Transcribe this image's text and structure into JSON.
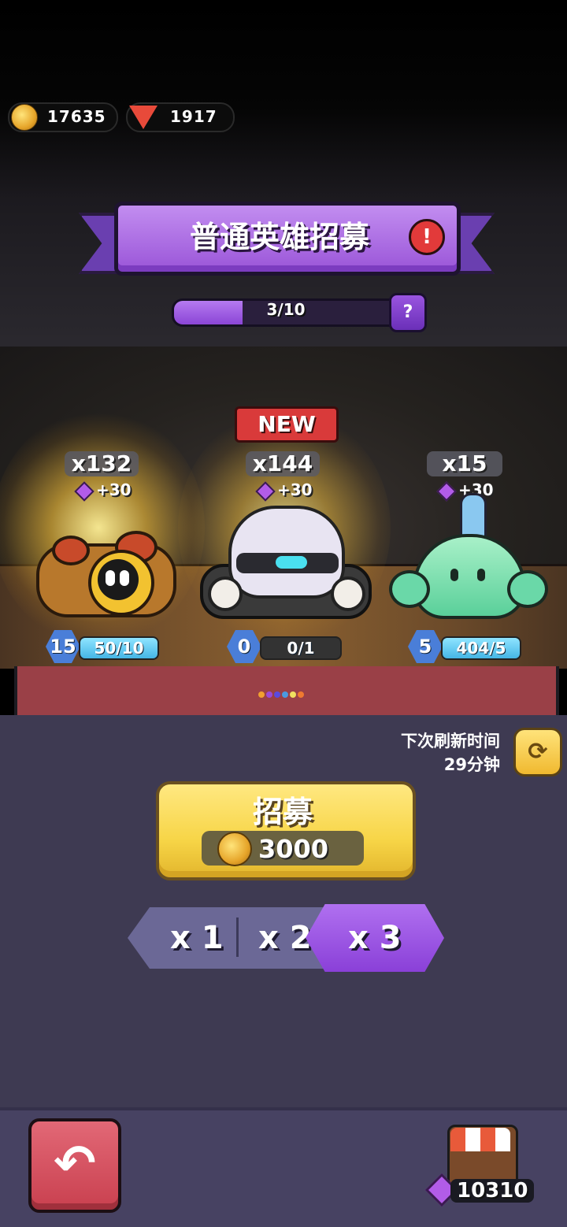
{
  "currency": {
    "coins": "17635",
    "gems": "1917"
  },
  "banner": {
    "title": "普通英雄招募",
    "alert_icon": "!"
  },
  "progress": {
    "text": "3/10",
    "value": 3,
    "max": 10,
    "help_icon": "?"
  },
  "new_badge": "NEW",
  "heroes": [
    {
      "name": "goggle-creature",
      "count": "x132",
      "bonus": "+30",
      "level": "15",
      "progress_text": "50/10",
      "progress_fraction": 1.0
    },
    {
      "name": "silver-hair-ninja",
      "count": "x144",
      "bonus": "+30",
      "level": "0",
      "progress_text": "0/1",
      "progress_fraction": 0.0
    },
    {
      "name": "green-slime",
      "count": "x15",
      "bonus": "+30",
      "level": "5",
      "progress_text": "404/5",
      "progress_fraction": 1.0
    }
  ],
  "refresh": {
    "label_line1": "下次刷新时间",
    "label_line2": "29分钟"
  },
  "recruit": {
    "label": "招募",
    "cost": "3000"
  },
  "multipliers": [
    "x 1",
    "x 2",
    "x 3"
  ],
  "selected_multiplier": "x 3",
  "shop": {
    "gems": "10310"
  },
  "colors": {
    "accent_purple": "#9a55d8",
    "recruit_yellow": "#f7d547",
    "back_red": "#c9404f",
    "panel_bg": "#3e3a52"
  }
}
